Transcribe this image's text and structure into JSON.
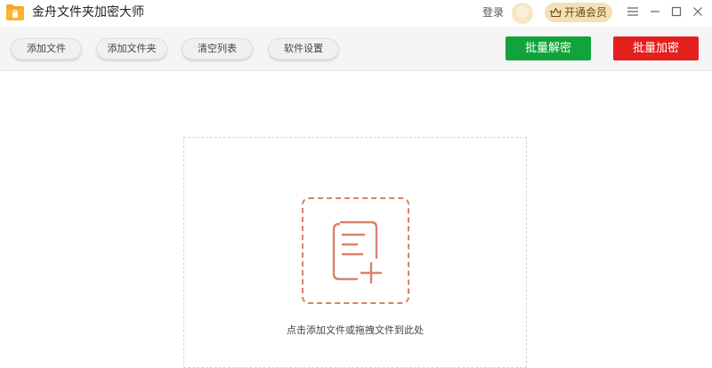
{
  "app": {
    "title": "金舟文件夹加密大师",
    "logo_icon": "folder-lock-icon",
    "accent_color": "#f5a623"
  },
  "header": {
    "login_label": "登录",
    "vip_label": "开通会员",
    "vip_icon": "crown-icon"
  },
  "window_controls": [
    "menu-icon",
    "minimize-icon",
    "maximize-icon",
    "close-icon"
  ],
  "toolbar": {
    "buttons": [
      {
        "label": "添加文件"
      },
      {
        "label": "添加文件夹"
      },
      {
        "label": "清空列表"
      },
      {
        "label": "软件设置"
      }
    ],
    "decrypt_label": "批量解密",
    "encrypt_label": "批量加密",
    "decrypt_color": "#11a43a",
    "encrypt_color": "#e4201e"
  },
  "drop_area": {
    "hint": "点击添加文件或拖拽文件到此处",
    "icon": "add-document-icon",
    "icon_color": "#d9826a"
  }
}
